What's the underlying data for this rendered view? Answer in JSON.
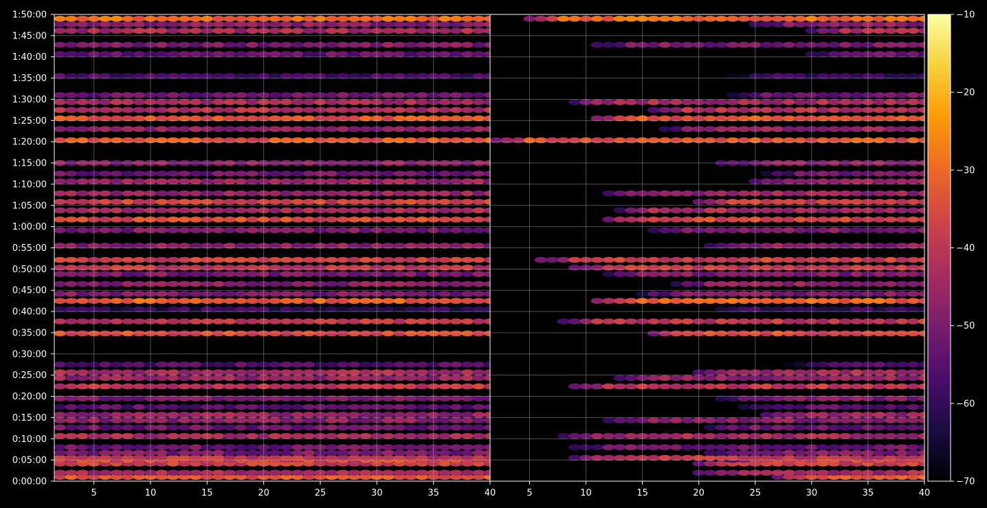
{
  "chart_data": {
    "type": "heatmap",
    "layout": "two side-by-side spectrogram-style panels sharing a y axis, one colorbar on the right",
    "colormap": "inferno",
    "background": "#000000",
    "grid": true,
    "title": "",
    "xlabel": "",
    "ylabel": "",
    "panels": [
      {
        "name": "left",
        "xlim": [
          1.5,
          40
        ],
        "xticks": [
          5,
          10,
          15,
          20,
          25,
          30,
          35,
          40
        ],
        "x_tick_labels": [
          "5",
          "10",
          "15",
          "20",
          "25",
          "30",
          "35",
          "40"
        ]
      },
      {
        "name": "right",
        "xlim": [
          1.5,
          40
        ],
        "xticks": [
          5,
          10,
          15,
          20,
          25,
          30,
          35,
          40
        ],
        "x_tick_labels": [
          "5",
          "10",
          "15",
          "20",
          "25",
          "30",
          "35",
          "40"
        ]
      }
    ],
    "y_axis": {
      "unit": "h:mm:ss",
      "ylim_seconds": [
        0,
        6600
      ],
      "tick_labels": [
        "0:00:00",
        "0:05:00",
        "0:10:00",
        "0:15:00",
        "0:20:00",
        "0:25:00",
        "0:30:00",
        "0:35:00",
        "0:40:00",
        "0:45:00",
        "0:50:00",
        "0:55:00",
        "1:00:00",
        "1:05:00",
        "1:10:00",
        "1:15:00",
        "1:20:00",
        "1:25:00",
        "1:30:00",
        "1:35:00",
        "1:40:00",
        "1:45:00",
        "1:50:00"
      ]
    },
    "colorbar": {
      "range": [
        -70,
        -10
      ],
      "ticks": [
        -10,
        -20,
        -30,
        -40,
        -50,
        -60,
        -70
      ],
      "tick_labels": [
        "−10",
        "−20",
        "−30",
        "−40",
        "−50",
        "−60",
        "−70"
      ]
    },
    "colors": {
      "grid": "#b4b4b4",
      "axes": "#ffffff",
      "scale": [
        "#000004",
        "#1b0c41",
        "#4a0c6b",
        "#781c6d",
        "#a52c60",
        "#cf4446",
        "#ed6925",
        "#fb9b06",
        "#f7d13d",
        "#fcffa4"
      ]
    },
    "bands": [
      {
        "time_seconds": 60,
        "level": -34,
        "right_start_x": 27
      },
      {
        "time_seconds": 120,
        "level": -44,
        "right_start_x": 20
      },
      {
        "time_seconds": 250,
        "level": -38,
        "right_start_x": 20
      },
      {
        "time_seconds": 300,
        "level": -36,
        "right_start_x": 23
      },
      {
        "time_seconds": 330,
        "level": -40,
        "right_start_x": 9
      },
      {
        "time_seconds": 400,
        "level": -50,
        "right_start_x": 21
      },
      {
        "time_seconds": 480,
        "level": -52,
        "right_start_x": 9
      },
      {
        "time_seconds": 640,
        "level": -44,
        "right_start_x": 8
      },
      {
        "time_seconds": 760,
        "level": -52,
        "right_start_x": 21
      },
      {
        "time_seconds": 860,
        "level": -48,
        "right_start_x": 12
      },
      {
        "time_seconds": 940,
        "level": -46,
        "right_start_x": 26
      },
      {
        "time_seconds": 1050,
        "level": -55,
        "right_start_x": 24
      },
      {
        "time_seconds": 1170,
        "level": -50,
        "right_start_x": 22
      },
      {
        "time_seconds": 1340,
        "level": -40,
        "right_start_x": 9
      },
      {
        "time_seconds": 1460,
        "level": -46,
        "right_start_x": 13
      },
      {
        "time_seconds": 1540,
        "level": -44,
        "right_start_x": 20
      },
      {
        "time_seconds": 1650,
        "level": -56,
        "right_start_x": 28
      },
      {
        "time_seconds": 2090,
        "level": -36,
        "right_start_x": 16
      },
      {
        "time_seconds": 2260,
        "level": -40,
        "right_start_x": 8
      },
      {
        "time_seconds": 2430,
        "level": -60,
        "right_start_x": 21
      },
      {
        "time_seconds": 2550,
        "level": -32,
        "right_start_x": 11
      },
      {
        "time_seconds": 2650,
        "level": -50,
        "right_start_x": 15
      },
      {
        "time_seconds": 2790,
        "level": -48,
        "right_start_x": 18
      },
      {
        "time_seconds": 2930,
        "level": -50,
        "right_start_x": 12
      },
      {
        "time_seconds": 3020,
        "level": -40,
        "right_start_x": 9
      },
      {
        "time_seconds": 3130,
        "level": -38,
        "right_start_x": 6
      },
      {
        "time_seconds": 3330,
        "level": -48,
        "right_start_x": 21
      },
      {
        "time_seconds": 3550,
        "level": -50,
        "right_start_x": 16
      },
      {
        "time_seconds": 3700,
        "level": -36,
        "right_start_x": 12
      },
      {
        "time_seconds": 3830,
        "level": -44,
        "right_start_x": 13
      },
      {
        "time_seconds": 3950,
        "level": -38,
        "right_start_x": 20
      },
      {
        "time_seconds": 4070,
        "level": -46,
        "right_start_x": 12
      },
      {
        "time_seconds": 4240,
        "level": -46,
        "right_start_x": 25
      },
      {
        "time_seconds": 4350,
        "level": -52,
        "right_start_x": 26
      },
      {
        "time_seconds": 4500,
        "level": -48,
        "right_start_x": 22
      },
      {
        "time_seconds": 4820,
        "level": -34,
        "right_start_x": 2
      },
      {
        "time_seconds": 4980,
        "level": -46,
        "right_start_x": 17
      },
      {
        "time_seconds": 5130,
        "level": -34,
        "right_start_x": 11
      },
      {
        "time_seconds": 5250,
        "level": -42,
        "right_start_x": 16
      },
      {
        "time_seconds": 5360,
        "level": -44,
        "right_start_x": 9
      },
      {
        "time_seconds": 5460,
        "level": -52,
        "right_start_x": 23
      },
      {
        "time_seconds": 5730,
        "level": -58,
        "right_start_x": 23
      },
      {
        "time_seconds": 6040,
        "level": -54,
        "right_start_x": 30
      },
      {
        "time_seconds": 6170,
        "level": -50,
        "right_start_x": 11
      },
      {
        "time_seconds": 6370,
        "level": -44,
        "right_start_x": 30
      },
      {
        "time_seconds": 6460,
        "level": -48,
        "right_start_x": 25
      },
      {
        "time_seconds": 6540,
        "level": -30,
        "right_start_x": 5
      }
    ]
  }
}
